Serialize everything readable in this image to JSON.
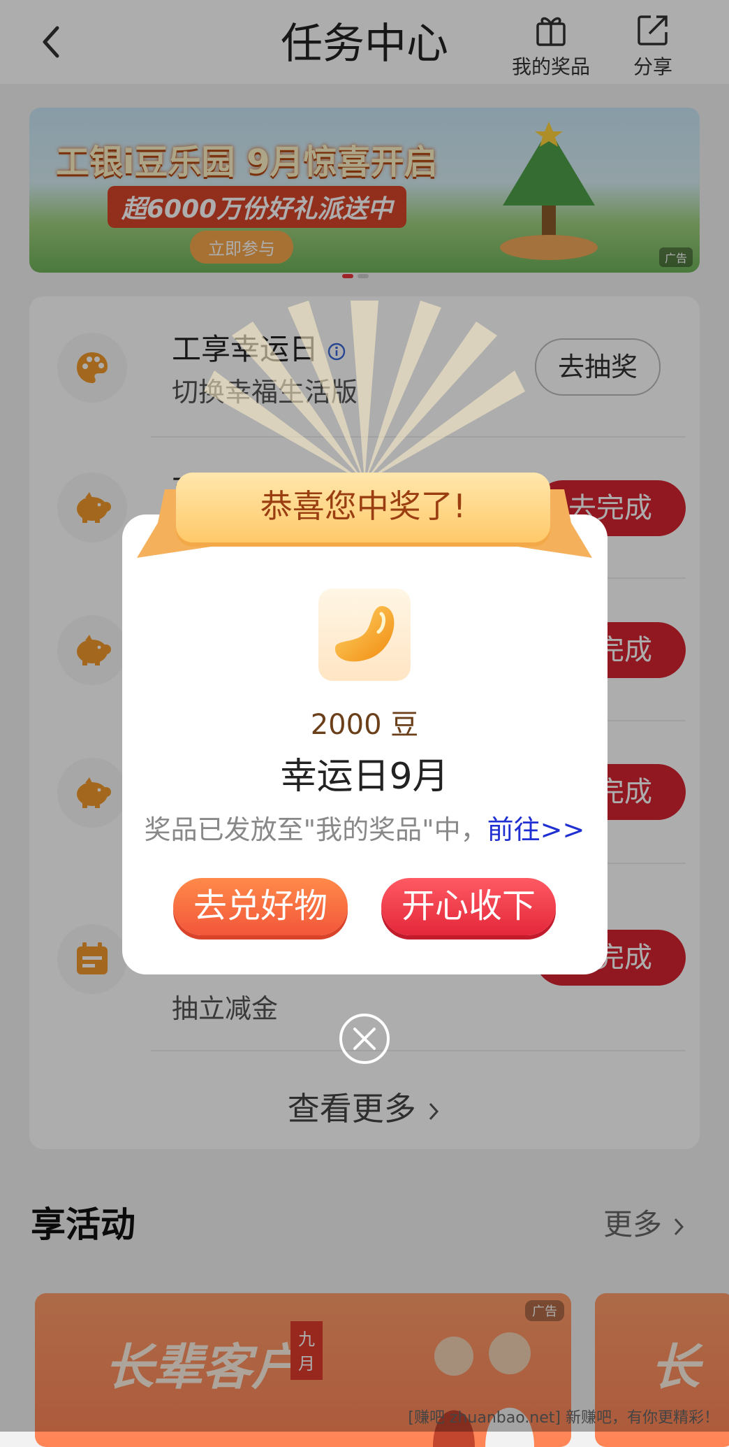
{
  "header": {
    "title": "任务中心",
    "my_prizes_label": "我的奖品",
    "share_label": "分享"
  },
  "banner": {
    "headline": "工银i豆乐园 9月惊喜开启",
    "subline": "超6000万份好礼派送中",
    "cta": "立即参与",
    "ad_tag": "广告"
  },
  "tasks": {
    "row1": {
      "title": "工享幸运日",
      "subtitle": "切换幸福生活版",
      "button": "去抽奖"
    },
    "row2": {
      "title": "可",
      "button": "去完成"
    },
    "row3": {
      "button": "去完成"
    },
    "row4": {
      "button": "去完成"
    },
    "row5": {
      "subtitle": "抽立减金",
      "button": "去完成"
    },
    "more": "查看更多"
  },
  "activities": {
    "title": "享活动",
    "more": "更多",
    "card1": {
      "text": "长辈客户",
      "badge": "九月",
      "ad_tag": "广告"
    },
    "card2": {
      "text": "长"
    }
  },
  "modal": {
    "ribbon": "恭喜您中奖了!",
    "prize_amount": "2000 豆",
    "prize_name": "幸运日9月",
    "note_prefix": "奖品已发放至\"我的奖品\"中，",
    "note_link": "前往>>",
    "btn_redeem": "去兑好物",
    "btn_accept": "开心收下"
  },
  "watermark": "[赚吧 zhuanbao.net] 新赚吧，有你更精彩！"
}
